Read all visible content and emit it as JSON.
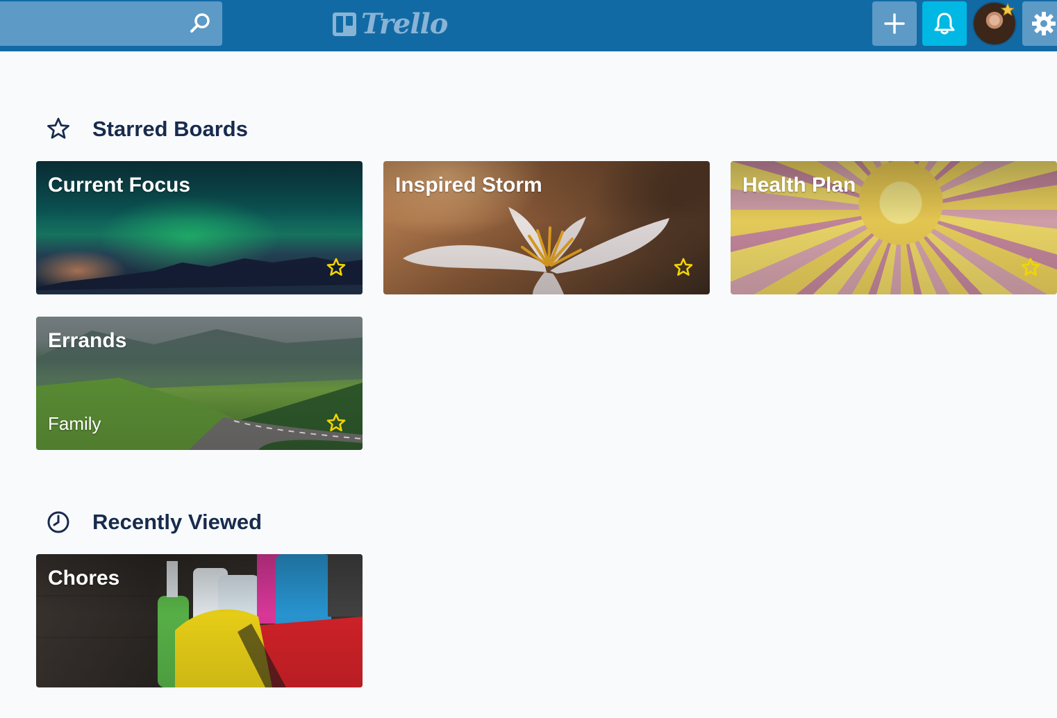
{
  "header": {
    "search": {
      "value": "",
      "placeholder": ""
    },
    "logo_text": "Trello",
    "icons": {
      "search": "search-icon",
      "add": "plus-icon",
      "notifications": "bell-icon",
      "settings": "gear-icon"
    }
  },
  "colors": {
    "header_bg": "#126aa5",
    "header_button_bg": "#5d9ac6",
    "notification_button_bg": "#00b8e3",
    "heading_text": "#172b4d",
    "star_color": "#f2d600",
    "page_bg": "#f9fafc"
  },
  "starred": {
    "heading": "Starred Boards",
    "icon": "star-outline-icon",
    "boards": [
      {
        "title": "Current Focus",
        "team": "",
        "starred": true
      },
      {
        "title": "Inspired Storm",
        "team": "",
        "starred": true
      },
      {
        "title": "Health Plan",
        "team": "",
        "starred": true
      },
      {
        "title": "Errands",
        "team": "Family",
        "starred": true
      }
    ]
  },
  "recent": {
    "heading": "Recently Viewed",
    "icon": "clock-icon",
    "boards": [
      {
        "title": "Chores",
        "team": ""
      }
    ]
  }
}
